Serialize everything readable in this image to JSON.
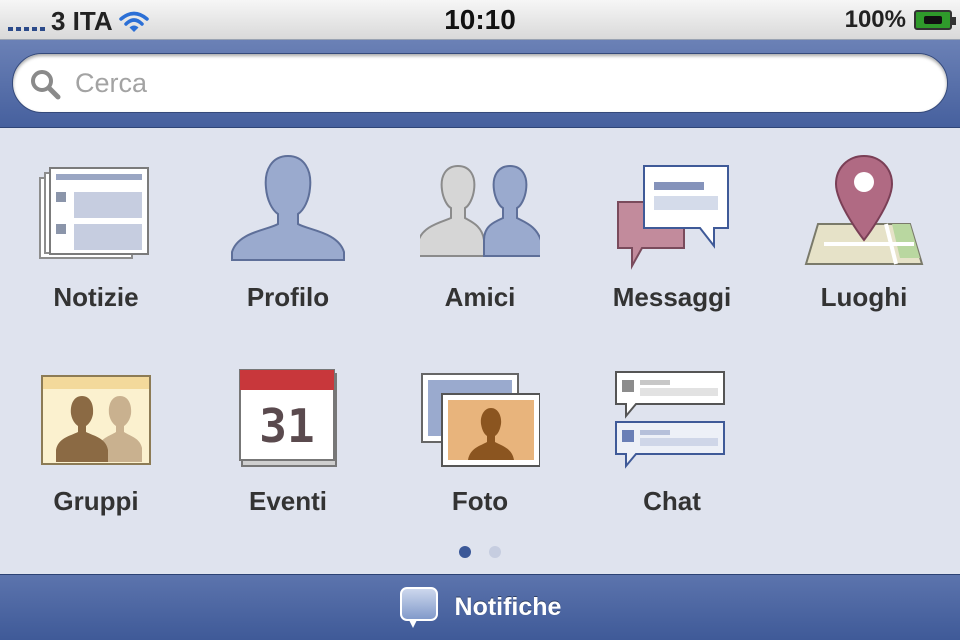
{
  "status_bar": {
    "carrier": "3 ITA",
    "time": "10:10",
    "battery": "100%",
    "signal_icon": "signal-bars-icon",
    "wifi_icon": "wifi-icon",
    "battery_icon": "battery-charging-icon"
  },
  "search": {
    "placeholder": "Cerca",
    "value": "",
    "icon": "search-icon"
  },
  "apps": [
    {
      "label": "Notizie",
      "icon": "news-feed-icon"
    },
    {
      "label": "Profilo",
      "icon": "profile-icon"
    },
    {
      "label": "Amici",
      "icon": "friends-icon"
    },
    {
      "label": "Messaggi",
      "icon": "messages-icon"
    },
    {
      "label": "Luoghi",
      "icon": "places-icon"
    },
    {
      "label": "Gruppi",
      "icon": "groups-icon"
    },
    {
      "label": "Eventi",
      "icon": "events-icon",
      "calendar_day": "31"
    },
    {
      "label": "Foto",
      "icon": "photos-icon"
    },
    {
      "label": "Chat",
      "icon": "chat-icon"
    }
  ],
  "pagination": {
    "pages": 2,
    "current": 1
  },
  "bottom_bar": {
    "label": "Notifiche",
    "icon": "notifications-icon"
  },
  "colors": {
    "brand_blue": "#3b5998",
    "background": "#dfe3ee",
    "label_text": "#333333"
  }
}
